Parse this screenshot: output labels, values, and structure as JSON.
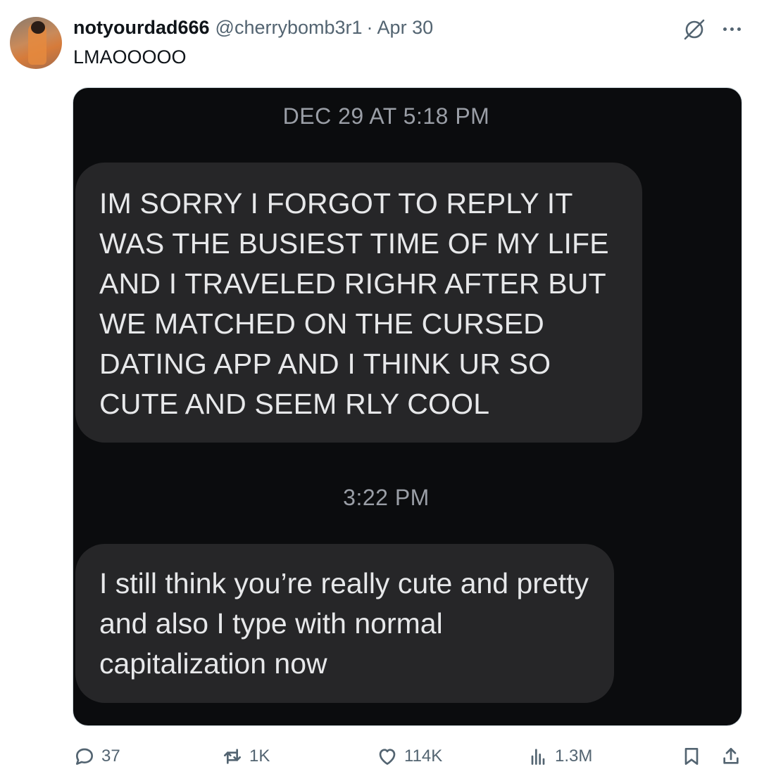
{
  "author": {
    "display_name": "notyourdad666",
    "handle": "@cherrybomb3r1",
    "separator": "·",
    "date": "Apr 30"
  },
  "tweet": {
    "text": "LMAOOOOO"
  },
  "media": {
    "timestamp_1": "DEC 29 AT 5:18 PM",
    "message_1": "IM SORRY I FORGOT TO REPLY IT WAS THE BUSIEST TIME OF MY LIFE AND I TRAVELED RIGHR AFTER BUT WE MATCHED ON THE CURSED DATING APP AND I THINK UR SO CUTE AND SEEM RLY COOL",
    "timestamp_2": "3:22 PM",
    "message_2": "I still think you’re really cute and pretty and also I type with normal capitalization now"
  },
  "actions": {
    "replies": "37",
    "reposts": "1K",
    "likes": "114K",
    "views": "1.3M"
  },
  "icons": {
    "more": "more-icon",
    "grok": "grok-icon",
    "reply": "reply-icon",
    "repost": "repost-icon",
    "like": "heart-icon",
    "views": "views-icon",
    "bookmark": "bookmark-icon",
    "share": "share-icon"
  }
}
